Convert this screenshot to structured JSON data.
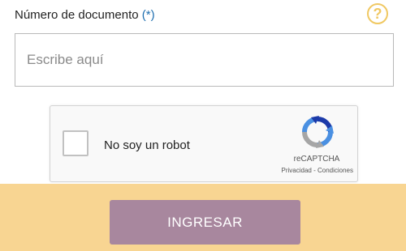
{
  "form": {
    "label": "Número de documento",
    "required_marker": "(*)",
    "help_icon_text": "?",
    "input_placeholder": "Escribe aquí",
    "input_value": ""
  },
  "captcha": {
    "checkbox_label": "No soy un robot",
    "brand": "reCAPTCHA",
    "privacy_link": "Privacidad",
    "separator": " - ",
    "terms_link": "Condiciones",
    "checked": false
  },
  "footer": {
    "submit_label": "INGRESAR"
  },
  "colors": {
    "help_icon": "#f0c862",
    "required_marker": "#1f6fb0",
    "footer_background": "#f8d592",
    "submit_background": "#a8879e"
  },
  "icons": {
    "help": "help-icon",
    "recaptcha": "recaptcha-logo-icon"
  }
}
